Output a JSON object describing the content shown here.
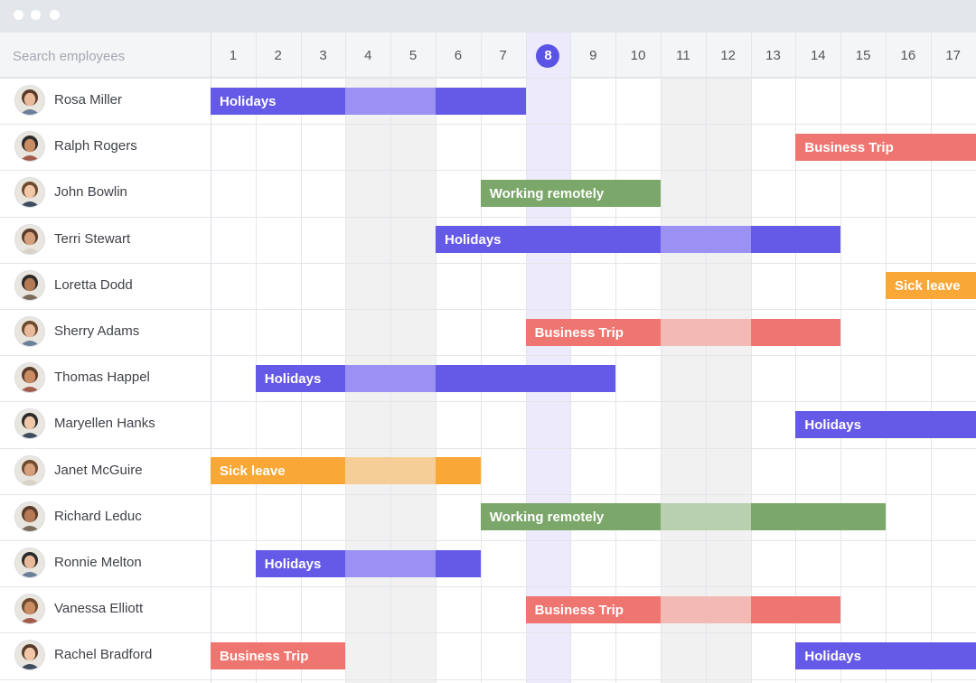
{
  "search": {
    "placeholder": "Search employees"
  },
  "days": [
    "1",
    "2",
    "3",
    "4",
    "5",
    "6",
    "7",
    "8",
    "9",
    "10",
    "11",
    "12",
    "13",
    "14",
    "15",
    "16",
    "17"
  ],
  "today_day": "8",
  "weekend_days": [
    "4",
    "5",
    "11",
    "12"
  ],
  "event_types": {
    "holidays": {
      "label": "Holidays",
      "color": "#6559e7",
      "weekend_color": "#9a91f3"
    },
    "business": {
      "label": "Business Trip",
      "color": "#ef7670",
      "weekend_color": "#f2b9b5"
    },
    "remote": {
      "label": "Working remotely",
      "color": "#7ba76a",
      "weekend_color": "#b9d0ae"
    },
    "sick": {
      "label": "Sick leave",
      "color": "#f9a736",
      "weekend_color": "#f5ce97"
    }
  },
  "employees": [
    {
      "name": "Rosa Miller",
      "avatar": "person-avatar-icon",
      "events": [
        {
          "type": "holidays",
          "start": 1,
          "end": 7
        }
      ]
    },
    {
      "name": "Ralph Rogers",
      "avatar": "person-avatar-icon",
      "events": [
        {
          "type": "business",
          "start": 14,
          "end": 17
        }
      ]
    },
    {
      "name": "John Bowlin",
      "avatar": "person-avatar-icon",
      "events": [
        {
          "type": "remote",
          "start": 7,
          "end": 10
        }
      ]
    },
    {
      "name": "Terri Stewart",
      "avatar": "person-avatar-icon",
      "events": [
        {
          "type": "holidays",
          "start": 6,
          "end": 14
        }
      ]
    },
    {
      "name": "Loretta Dodd",
      "avatar": "person-avatar-icon",
      "events": [
        {
          "type": "sick",
          "start": 16,
          "end": 17
        }
      ]
    },
    {
      "name": "Sherry Adams",
      "avatar": "person-avatar-icon",
      "events": [
        {
          "type": "business",
          "start": 8,
          "end": 14
        }
      ]
    },
    {
      "name": "Thomas Happel",
      "avatar": "person-avatar-icon",
      "events": [
        {
          "type": "holidays",
          "start": 2,
          "end": 9
        }
      ]
    },
    {
      "name": "Maryellen Hanks",
      "avatar": "person-avatar-icon",
      "events": [
        {
          "type": "holidays",
          "start": 14,
          "end": 17
        }
      ]
    },
    {
      "name": "Janet McGuire",
      "avatar": "person-avatar-icon",
      "events": [
        {
          "type": "sick",
          "start": 1,
          "end": 6
        }
      ]
    },
    {
      "name": "Richard Leduc",
      "avatar": "person-avatar-icon",
      "events": [
        {
          "type": "remote",
          "start": 7,
          "end": 15
        }
      ]
    },
    {
      "name": "Ronnie Melton",
      "avatar": "person-avatar-icon",
      "events": [
        {
          "type": "holidays",
          "start": 2,
          "end": 6
        }
      ]
    },
    {
      "name": "Vanessa Elliott",
      "avatar": "person-avatar-icon",
      "events": [
        {
          "type": "business",
          "start": 8,
          "end": 14
        }
      ]
    },
    {
      "name": "Rachel Bradford",
      "avatar": "person-avatar-icon",
      "events": [
        {
          "type": "business",
          "start": 1,
          "end": 3
        },
        {
          "type": "holidays",
          "start": 14,
          "end": 17
        }
      ]
    }
  ]
}
